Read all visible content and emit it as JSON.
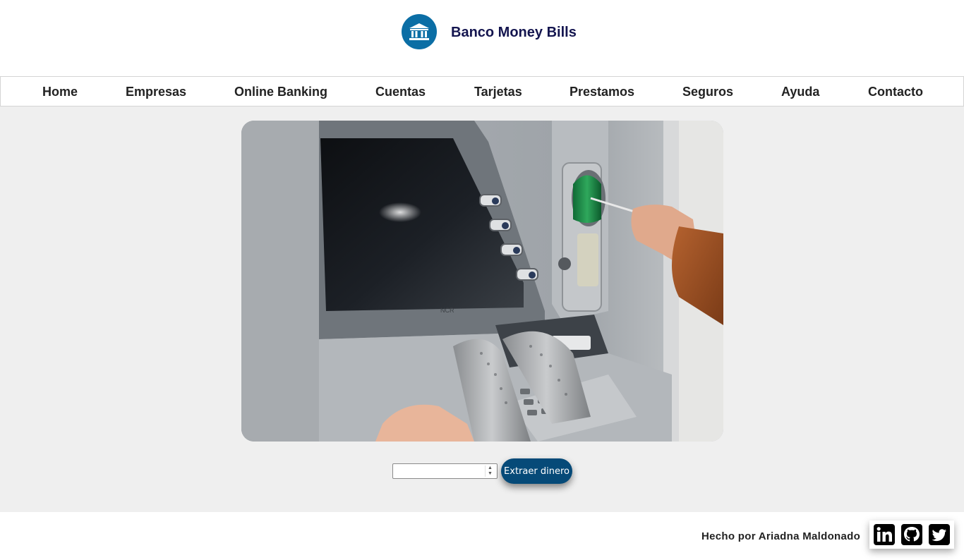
{
  "brand": {
    "name": "Banco Money Bills",
    "logo_icon": "bank-building-icon",
    "logo_color": "#0b6ea5"
  },
  "nav": {
    "items": [
      {
        "label": "Home"
      },
      {
        "label": "Empresas"
      },
      {
        "label": "Online Banking"
      },
      {
        "label": "Cuentas"
      },
      {
        "label": "Tarjetas"
      },
      {
        "label": "Prestamos"
      },
      {
        "label": "Seguros"
      },
      {
        "label": "Ayuda"
      },
      {
        "label": "Contacto"
      }
    ]
  },
  "main": {
    "photo": "atm-card-insertion-photo",
    "amount_input": {
      "value": "",
      "placeholder": ""
    },
    "extract_button": {
      "label": "Extraer dinero",
      "color": "#064a78"
    }
  },
  "footer": {
    "credit": "Hecho por Ariadna Maldonado",
    "social": [
      {
        "icon": "linkedin-icon"
      },
      {
        "icon": "github-icon"
      },
      {
        "icon": "twitter-icon"
      }
    ]
  }
}
